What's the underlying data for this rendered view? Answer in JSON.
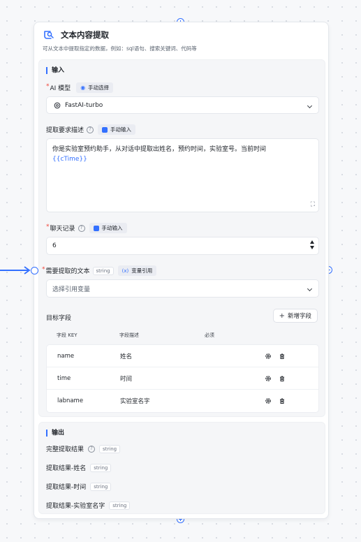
{
  "node": {
    "title": "文本内容提取",
    "description": "可从文本中提取指定的数据，例如：sql语句、搜索关键词、代码等"
  },
  "input_section": {
    "title": "输入",
    "ai_model": {
      "label": "AI 模型",
      "mode_label": "手动选择",
      "value": "FastAI-turbo"
    },
    "requirement": {
      "label": "提取要求描述",
      "mode_label": "手动输入",
      "text": "你是实验室预约助手，从对话中提取出姓名，预约时间，实验室号。当前时间",
      "variable": "{{cTime}}"
    },
    "history": {
      "label": "聊天记录",
      "mode_label": "手动输入",
      "value": "6"
    },
    "source_text": {
      "label": "需要提取的文本",
      "type_tag": "string",
      "mode_label": "变量引用",
      "placeholder": "选择引用变量"
    },
    "target_fields": {
      "label": "目标字段",
      "add_label": "新增字段",
      "headers": [
        "字段 KEY",
        "字段描述",
        "必须"
      ],
      "rows": [
        {
          "key": "name",
          "desc": "姓名"
        },
        {
          "key": "time",
          "desc": "时间"
        },
        {
          "key": "labname",
          "desc": "实验室名字"
        }
      ]
    }
  },
  "output_section": {
    "title": "输出",
    "items": [
      {
        "label": "完整提取结果",
        "type": "string",
        "has_help": true
      },
      {
        "label": "提取结果-姓名",
        "type": "string"
      },
      {
        "label": "提取结果-时间",
        "type": "string"
      },
      {
        "label": "提取结果-实验室名字",
        "type": "string"
      }
    ]
  },
  "colors": {
    "accent": "#3370ff",
    "required": "#f04438"
  }
}
